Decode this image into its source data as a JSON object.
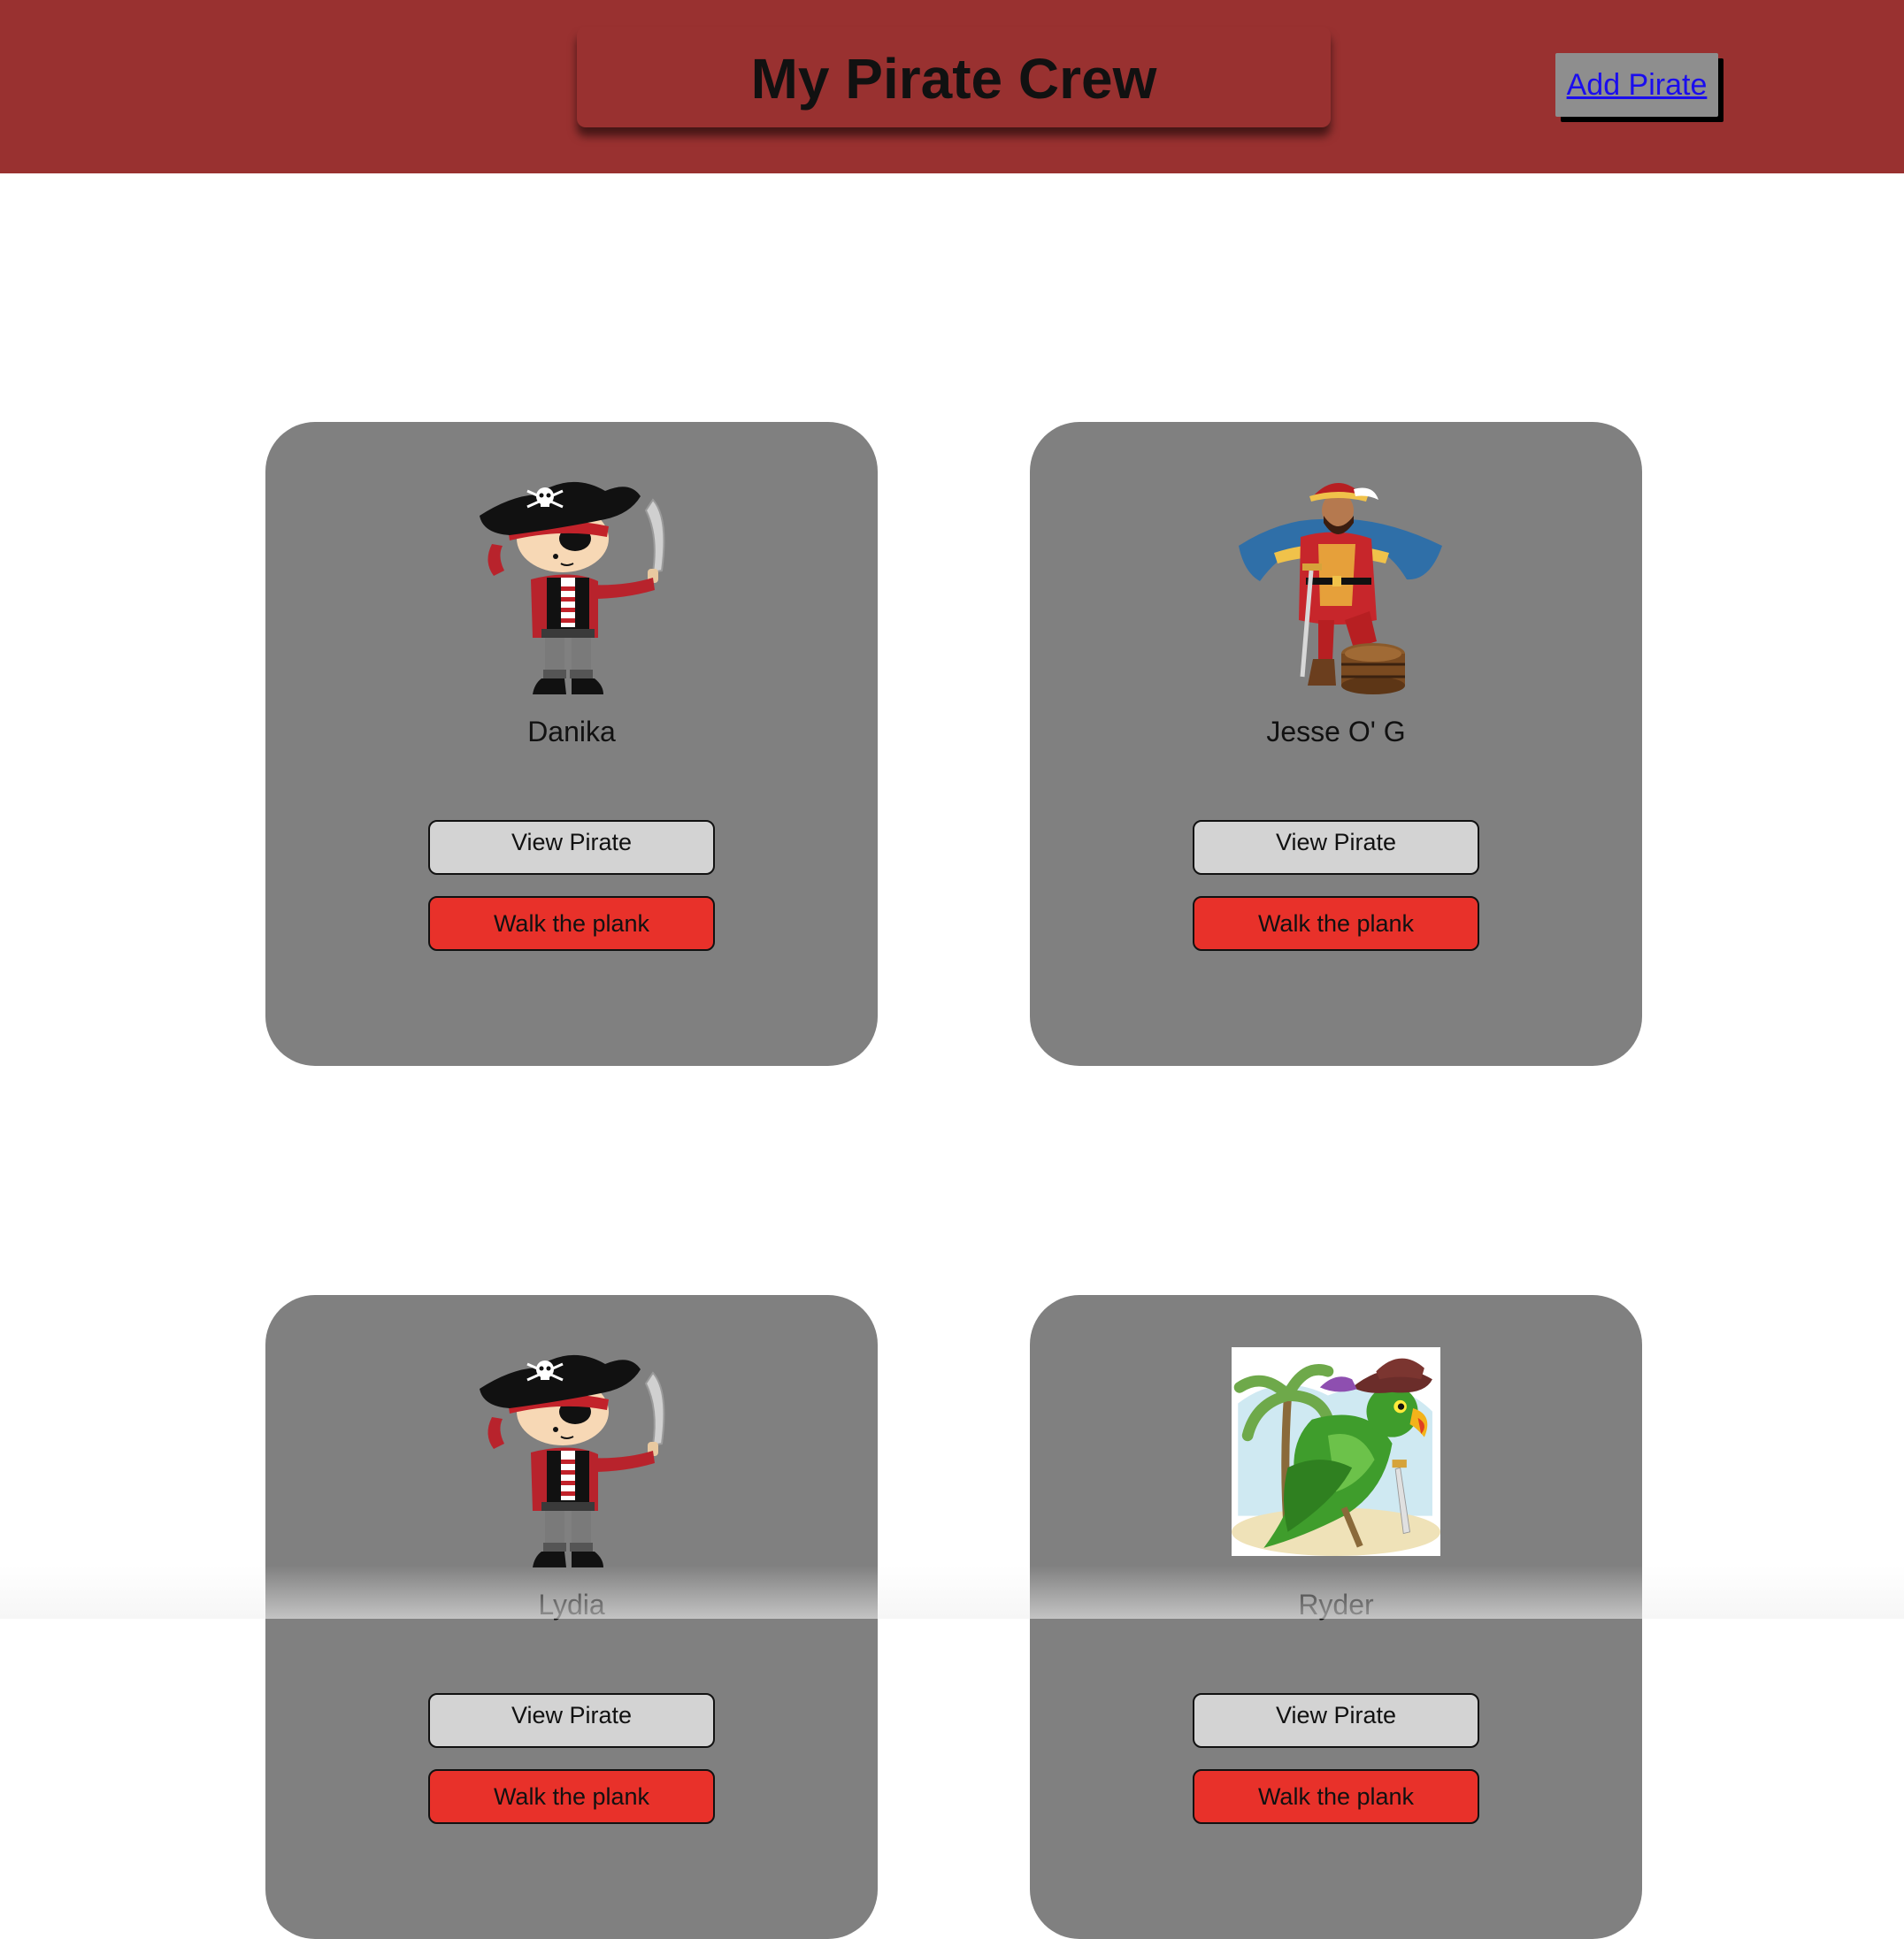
{
  "header": {
    "title": "My Pirate Crew",
    "add_pirate_label": "Add Pirate"
  },
  "colors": {
    "header_bg": "#993130",
    "card_bg": "#808080",
    "view_button_bg": "#d3d3d3",
    "plank_button_bg": "#e8312a",
    "link": "#1a0dee"
  },
  "pirates": [
    {
      "name": "Danika",
      "image": "pirate-boy-illustration",
      "view_label": "View Pirate",
      "plank_label": "Walk the plank"
    },
    {
      "name": "Jesse O' G",
      "image": "pirate-captain-on-barrel-illustration",
      "view_label": "View Pirate",
      "plank_label": "Walk the plank"
    },
    {
      "name": "Lydia",
      "image": "pirate-boy-illustration",
      "view_label": "View Pirate",
      "plank_label": "Walk the plank"
    },
    {
      "name": "Ryder",
      "image": "pirate-parrot-illustration",
      "view_label": "View Pirate",
      "plank_label": "Walk the plank"
    }
  ]
}
